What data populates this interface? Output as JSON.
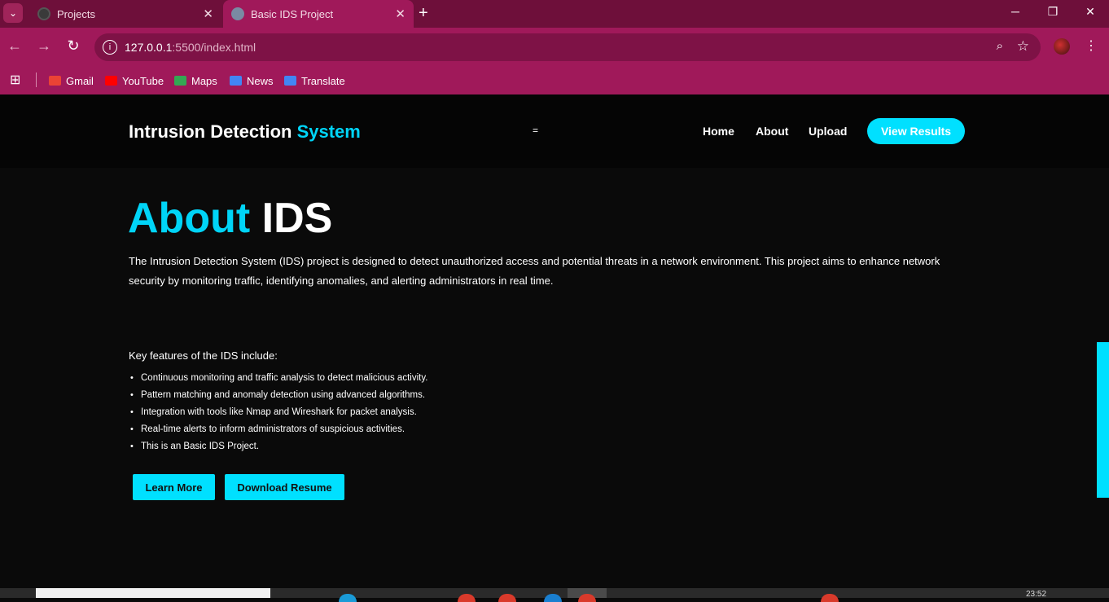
{
  "browser": {
    "tabs": [
      {
        "title": "Projects"
      },
      {
        "title": "Basic IDS Project"
      }
    ],
    "url_host": "127.0.0.1",
    "url_path": ":5500/index.html",
    "bookmarks": [
      {
        "label": "Gmail",
        "color": "#ea4335"
      },
      {
        "label": "YouTube",
        "color": "#ff0000"
      },
      {
        "label": "Maps",
        "color": "#34a853"
      },
      {
        "label": "News",
        "color": "#4285f4"
      },
      {
        "label": "Translate",
        "color": "#4285f4"
      }
    ]
  },
  "site": {
    "logo_main": "Intrusion Detection",
    "logo_accent": "System",
    "menu_toggle": "=",
    "nav": [
      {
        "label": "Home"
      },
      {
        "label": "About"
      },
      {
        "label": "Upload"
      }
    ],
    "cta_label": "View Results",
    "accent_color": "#00d4f7"
  },
  "about": {
    "title_accent": "About",
    "title_main": "IDS",
    "intro": "The Intrusion Detection System (IDS) project is designed to detect unauthorized access and potential threats in a network environment. This project aims to enhance network security by monitoring traffic, identifying anomalies, and alerting administrators in real time.",
    "features_title": "Key features of the IDS include:",
    "features": [
      "Continuous monitoring and traffic analysis to detect malicious activity.",
      "Pattern matching and anomaly detection using advanced algorithms.",
      "Integration with tools like Nmap and Wireshark for packet analysis.",
      "Real-time alerts to inform administrators of suspicious activities.",
      "This is an Basic IDS Project."
    ],
    "learn_more_label": "Learn More",
    "download_label": "Download Resume"
  },
  "taskbar": {
    "time": "23:52"
  }
}
